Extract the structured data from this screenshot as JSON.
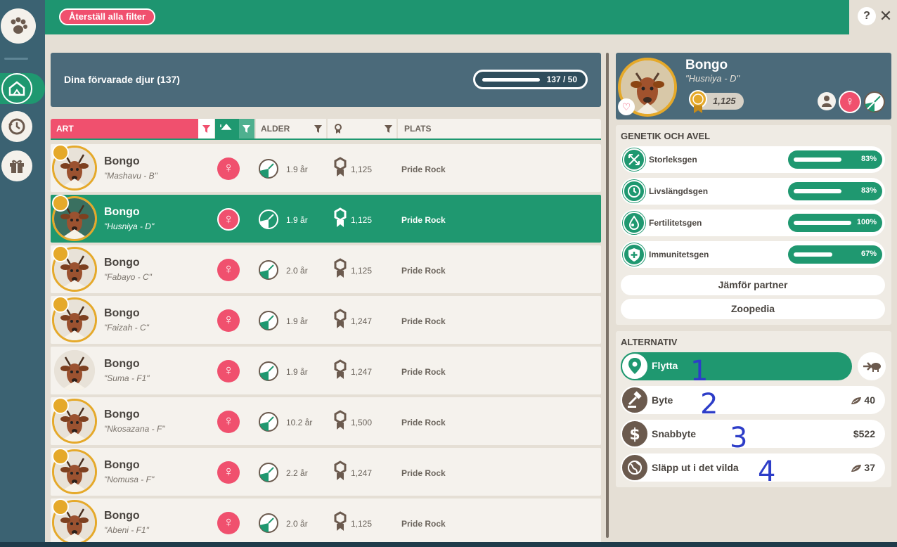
{
  "colors": {
    "accent_green": "#1f9870",
    "accent_pink": "#f0506e",
    "gold": "#e5a92a",
    "slate": "#4b6a7a"
  },
  "toolbar": {
    "reset_label": "Återställ alla filter",
    "help_label": "?",
    "close_label": "✕"
  },
  "sidebar": {
    "items": [
      {
        "name": "paw-icon"
      },
      {
        "name": "habitat-icon",
        "active": true
      },
      {
        "name": "history-icon"
      },
      {
        "name": "gift-icon"
      }
    ]
  },
  "storage": {
    "title": "Dina förvarade djur (137)",
    "capacity_text": "137 / 50",
    "capacity_fraction": 1.0
  },
  "columns": {
    "species": "ART",
    "age": "ALDER",
    "place": "PLATS"
  },
  "rows": [
    {
      "name": "Bongo",
      "nick": "\"Mashavu - B\"",
      "gender": "♀",
      "age": "1.9 år",
      "score": "1,125",
      "place": "Pride Rock",
      "medal": true,
      "selected": false
    },
    {
      "name": "Bongo",
      "nick": "\"Husniya - D\"",
      "gender": "♀",
      "age": "1.9 år",
      "score": "1,125",
      "place": "Pride Rock",
      "medal": true,
      "selected": true
    },
    {
      "name": "Bongo",
      "nick": "\"Fabayo - C\"",
      "gender": "♀",
      "age": "2.0 år",
      "score": "1,125",
      "place": "Pride Rock",
      "medal": true,
      "selected": false
    },
    {
      "name": "Bongo",
      "nick": "\"Faizah - C\"",
      "gender": "♀",
      "age": "1.9 år",
      "score": "1,247",
      "place": "Pride Rock",
      "medal": true,
      "selected": false
    },
    {
      "name": "Bongo",
      "nick": "\"Suma - F1\"",
      "gender": "♀",
      "age": "1.9 år",
      "score": "1,247",
      "place": "Pride Rock",
      "medal": false,
      "selected": false
    },
    {
      "name": "Bongo",
      "nick": "\"Nkosazana - F\"",
      "gender": "♀",
      "age": "10.2 år",
      "score": "1,500",
      "place": "Pride Rock",
      "medal": true,
      "selected": false
    },
    {
      "name": "Bongo",
      "nick": "\"Nomusa - F\"",
      "gender": "♀",
      "age": "2.2 år",
      "score": "1,247",
      "place": "Pride Rock",
      "medal": true,
      "selected": false
    },
    {
      "name": "Bongo",
      "nick": "\"Abeni - F1\"",
      "gender": "♀",
      "age": "2.0 år",
      "score": "1,125",
      "place": "Pride Rock",
      "medal": true,
      "selected": false
    }
  ],
  "detail": {
    "name": "Bongo",
    "nick": "\"Husniya - D\"",
    "score": "1,125",
    "gender": "♀"
  },
  "genetics": {
    "title": "GENETIK OCH AVEL",
    "genes": [
      {
        "label": "Storleksgen",
        "value": "83%",
        "fraction": 0.83,
        "icon": "expand-icon"
      },
      {
        "label": "Livslängdsgen",
        "value": "83%",
        "fraction": 0.83,
        "icon": "clock-icon"
      },
      {
        "label": "Fertilitetsgen",
        "value": "100%",
        "fraction": 1.0,
        "icon": "fertility-icon"
      },
      {
        "label": "Immunitetsgen",
        "value": "67%",
        "fraction": 0.67,
        "icon": "shield-plus-icon"
      }
    ],
    "compare_label": "Jämför partner",
    "zoopedia_label": "Zoopedia"
  },
  "options": {
    "title": "ALTERNATIV",
    "move_label": "Flytta",
    "items": [
      {
        "label": "Byte",
        "value": "40",
        "icon": "gavel-icon",
        "currency": "leaf"
      },
      {
        "label": "Snabbyte",
        "value": "$522",
        "icon": "dollar-icon",
        "currency": "cash"
      },
      {
        "label": "Släpp ut i det vilda",
        "value": "37",
        "icon": "globe-icon",
        "currency": "leaf"
      }
    ]
  },
  "annotations": [
    "1",
    "2",
    "3",
    "4"
  ]
}
